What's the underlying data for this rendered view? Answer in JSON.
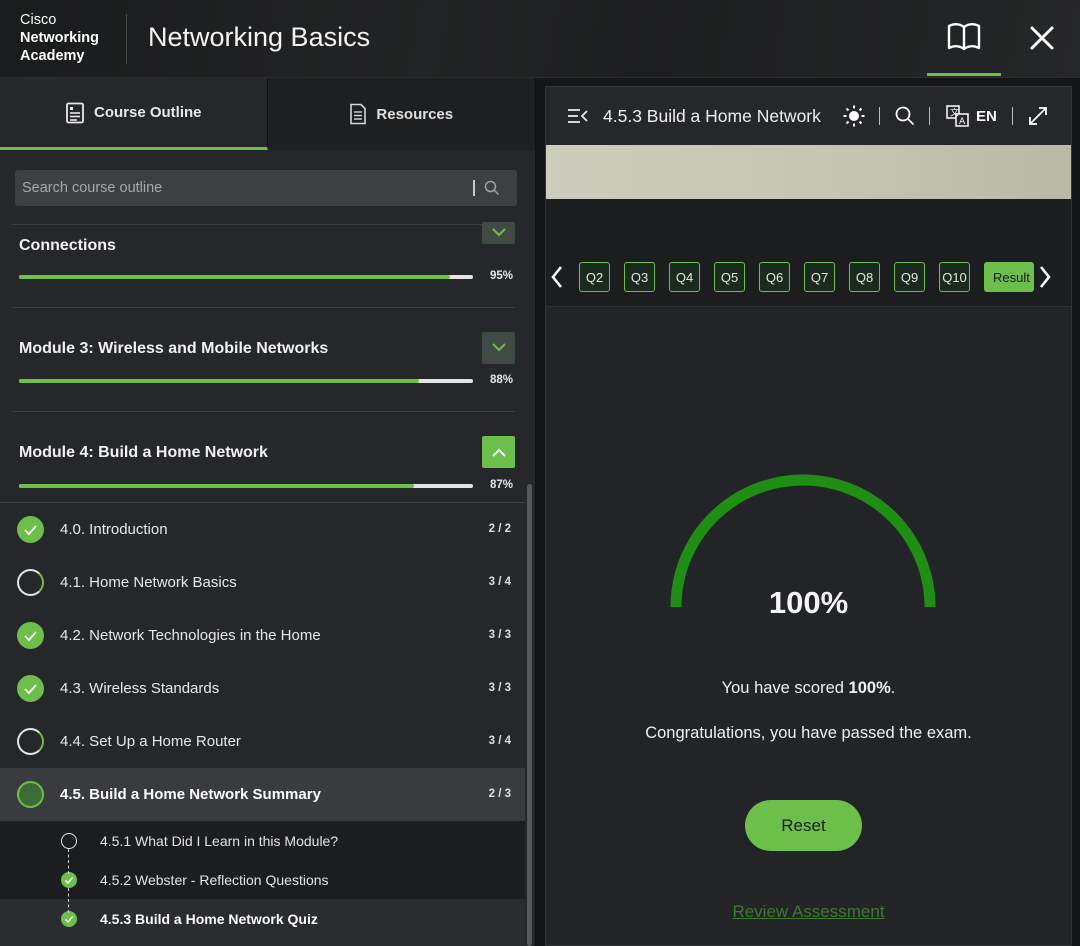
{
  "header": {
    "logo_line1": "Cisco",
    "logo_line2": "Networking",
    "logo_line3": "Academy",
    "course_title": "Networking Basics",
    "book_icon": "book-icon",
    "close_icon": "close-icon"
  },
  "left_panel": {
    "tabs": [
      {
        "label": "Course Outline",
        "icon": "outline-icon",
        "active": true
      },
      {
        "label": "Resources",
        "icon": "document-icon",
        "active": false
      }
    ],
    "search": {
      "placeholder": "Search course outline"
    },
    "modules": [
      {
        "title": "Connections",
        "percent_label": "95%",
        "progress": 95,
        "expanded": false
      },
      {
        "title": "Module 3: Wireless and Mobile Networks",
        "percent_label": "88%",
        "progress": 88,
        "expanded": false
      },
      {
        "title": "Module 4: Build a Home Network",
        "percent_label": "87%",
        "progress": 87,
        "expanded": true
      }
    ],
    "items": [
      {
        "label": "4.0. Introduction",
        "count": "2 / 2",
        "status": "complete"
      },
      {
        "label": "4.1. Home Network Basics",
        "count": "3 / 4",
        "status": "partial"
      },
      {
        "label": "4.2. Network Technologies in the Home",
        "count": "3 / 3",
        "status": "complete"
      },
      {
        "label": "4.3. Wireless Standards",
        "count": "3 / 3",
        "status": "complete"
      },
      {
        "label": "4.4. Set Up a Home Router",
        "count": "3 / 4",
        "status": "partial"
      },
      {
        "label": "4.5. Build a Home Network Summary",
        "count": "2 / 3",
        "status": "partial",
        "selected": true
      }
    ],
    "subitems": [
      {
        "label": "4.5.1 What Did I Learn in this Module?",
        "status": "incomplete"
      },
      {
        "label": "4.5.2 Webster - Reflection Questions",
        "status": "complete"
      },
      {
        "label": "4.5.3 Build a Home Network Quiz",
        "status": "complete",
        "selected": true
      }
    ]
  },
  "content": {
    "title": "4.5.3 Build a Home Network",
    "language": "EN",
    "questions": [
      "Q2",
      "Q3",
      "Q4",
      "Q5",
      "Q6",
      "Q7",
      "Q8",
      "Q9",
      "Q10"
    ],
    "result_label": "Result",
    "score_percent": 100,
    "score_label": "100%",
    "scored_prefix": "You have scored ",
    "scored_value": "100%",
    "scored_suffix": ".",
    "congrats": "Congratulations, you have passed the exam.",
    "reset_label": "Reset",
    "review_label": "Review Assessment",
    "colors": {
      "accent": "#6cc04a",
      "gauge": "#1f8f14"
    }
  }
}
